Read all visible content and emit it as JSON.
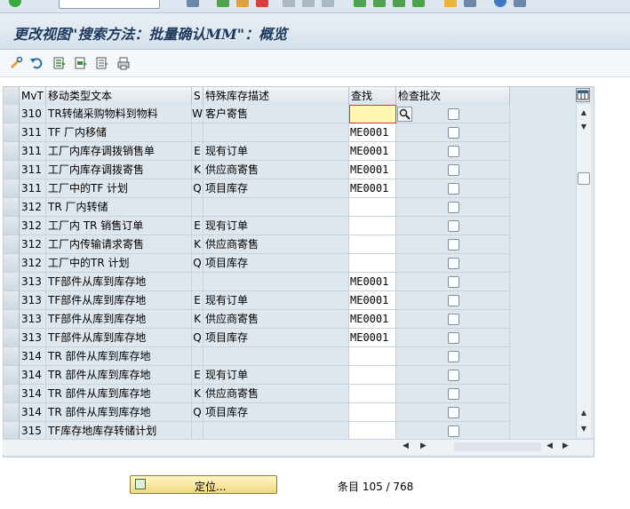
{
  "title": "更改视图\"搜索方法：批量确认MM\"：概览",
  "columns": {
    "mvt": "MvT",
    "text": "移动类型文本",
    "s": "S",
    "special_stock_desc": "特殊库存描述",
    "find": "查找",
    "check_batch": "检查批次"
  },
  "rows": [
    {
      "mvt": "310",
      "text": "TR转储采购物料到物料",
      "s": "W",
      "desc": "客户寄售",
      "find": ""
    },
    {
      "mvt": "311",
      "text": "TF 厂内移储",
      "s": "",
      "desc": "",
      "find": "ME0001"
    },
    {
      "mvt": "311",
      "text": "工厂内库存调拨销售单",
      "s": "E",
      "desc": "现有订单",
      "find": "ME0001"
    },
    {
      "mvt": "311",
      "text": "工厂内库存调拨寄售",
      "s": "K",
      "desc": "供应商寄售",
      "find": "ME0001"
    },
    {
      "mvt": "311",
      "text": "工厂中的TF 计划",
      "s": "Q",
      "desc": "项目库存",
      "find": "ME0001"
    },
    {
      "mvt": "312",
      "text": "TR 厂内转储",
      "s": "",
      "desc": "",
      "find": ""
    },
    {
      "mvt": "312",
      "text": "工厂内 TR 销售订单",
      "s": "E",
      "desc": "现有订单",
      "find": ""
    },
    {
      "mvt": "312",
      "text": "工厂内传输请求寄售",
      "s": "K",
      "desc": "供应商寄售",
      "find": ""
    },
    {
      "mvt": "312",
      "text": "工厂中的TR 计划",
      "s": "Q",
      "desc": "项目库存",
      "find": ""
    },
    {
      "mvt": "313",
      "text": "TF部件从库到库存地",
      "s": "",
      "desc": "",
      "find": "ME0001"
    },
    {
      "mvt": "313",
      "text": "TF部件从库到库存地",
      "s": "E",
      "desc": "现有订单",
      "find": "ME0001"
    },
    {
      "mvt": "313",
      "text": "TF部件从库到库存地",
      "s": "K",
      "desc": "供应商寄售",
      "find": "ME0001"
    },
    {
      "mvt": "313",
      "text": "TF部件从库到库存地",
      "s": "Q",
      "desc": "项目库存",
      "find": "ME0001"
    },
    {
      "mvt": "314",
      "text": "TR 部件从库到库存地",
      "s": "",
      "desc": "",
      "find": ""
    },
    {
      "mvt": "314",
      "text": "TR 部件从库到库存地",
      "s": "E",
      "desc": "现有订单",
      "find": ""
    },
    {
      "mvt": "314",
      "text": "TR 部件从库到库存地",
      "s": "K",
      "desc": "供应商寄售",
      "find": ""
    },
    {
      "mvt": "314",
      "text": "TR 部件从库到库存地",
      "s": "Q",
      "desc": "项目库存",
      "find": ""
    },
    {
      "mvt": "315",
      "text": "TF库存地库存转储计划",
      "s": "",
      "desc": "",
      "find": ""
    }
  ],
  "footer": {
    "locate_label": "定位...",
    "entry_label": "条目 105 / 768"
  },
  "colors": {
    "title_text": "#1d3a5f",
    "table_bg": "#dfe7ee",
    "focus_border": "#d23a3a",
    "focus_bg": "#fff6b3",
    "locate_button": "#f1d980"
  },
  "icons": {
    "app_toolbar": [
      "change-glasses-icon",
      "undo-icon",
      "select-all-icon",
      "select-block-icon",
      "deselect-all-icon",
      "print-icon"
    ]
  }
}
